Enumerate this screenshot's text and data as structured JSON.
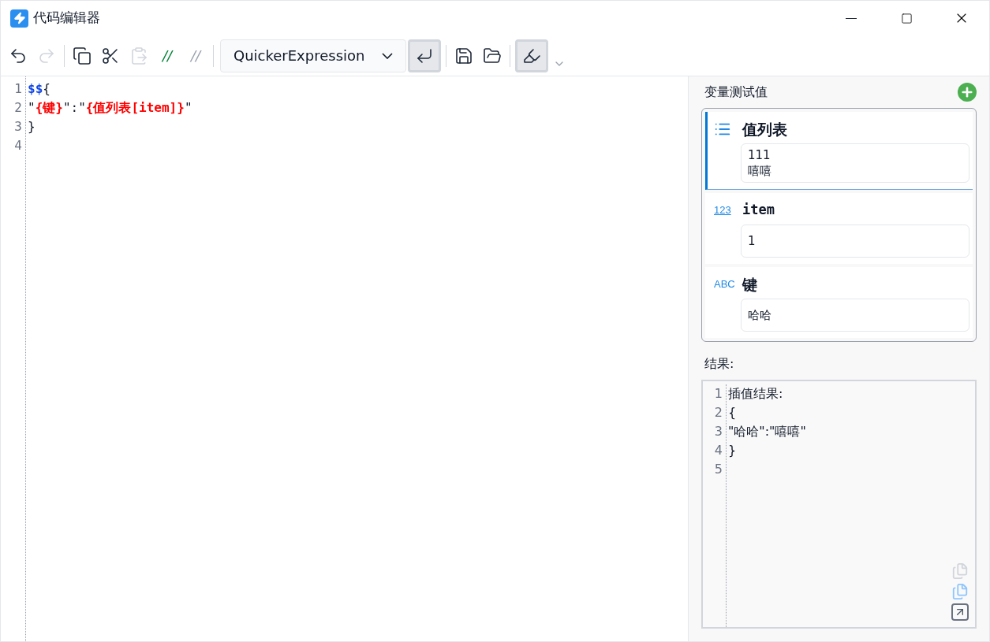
{
  "window": {
    "title": "代码编辑器"
  },
  "toolbar": [
    {
      "kind": "undo",
      "disabled": false
    },
    {
      "kind": "redo",
      "disabled": true
    },
    {
      "kind": "sep"
    },
    {
      "kind": "copy",
      "disabled": false
    },
    {
      "kind": "cut",
      "disabled": false
    },
    {
      "kind": "paste",
      "disabled": true
    },
    {
      "kind": "comment",
      "text": "//",
      "disabled": false
    },
    {
      "kind": "uncomment",
      "text": "//",
      "disabled": true
    },
    {
      "kind": "sep"
    },
    {
      "kind": "dropdown",
      "value": "QuickerExpression"
    },
    {
      "kind": "wrap",
      "pressed": true
    },
    {
      "kind": "sep"
    },
    {
      "kind": "save",
      "disabled": false
    },
    {
      "kind": "open",
      "disabled": false
    },
    {
      "kind": "sep"
    },
    {
      "kind": "highlight",
      "pressed": true
    },
    {
      "kind": "more"
    }
  ],
  "editor": {
    "lines": [
      {
        "number": "1",
        "segments": [
          {
            "kind": "dollar",
            "text": "$$"
          },
          {
            "kind": "plain",
            "text": "{"
          }
        ]
      },
      {
        "number": "2",
        "segments": [
          {
            "kind": "plain",
            "text": "\""
          },
          {
            "kind": "interp",
            "text": "{键}"
          },
          {
            "kind": "plain",
            "text": "\":\""
          },
          {
            "kind": "interp",
            "text": "{值列表[item]}"
          },
          {
            "kind": "plain",
            "text": "\""
          }
        ]
      },
      {
        "number": "3",
        "segments": [
          {
            "kind": "plain",
            "text": "}"
          }
        ]
      },
      {
        "number": "4"
      }
    ]
  },
  "variables": {
    "title": "变量测试值",
    "items": [
      {
        "kind": "list",
        "name": "值列表",
        "value": "111\n嘻嘻",
        "selected": true
      },
      {
        "kind": "number",
        "badge": "123",
        "name": "item",
        "value": "1",
        "selected": false
      },
      {
        "kind": "text",
        "badge": "ABC",
        "name": "键",
        "value": "哈哈",
        "selected": false
      }
    ]
  },
  "result": {
    "title": "结果:",
    "lines": [
      {
        "number": "1",
        "text": "插值结果:"
      },
      {
        "number": "2",
        "text": "{"
      },
      {
        "number": "3",
        "text": "\"哈哈\":\"嘻嘻\""
      },
      {
        "number": "4",
        "text": "}"
      },
      {
        "number": "5"
      }
    ]
  }
}
